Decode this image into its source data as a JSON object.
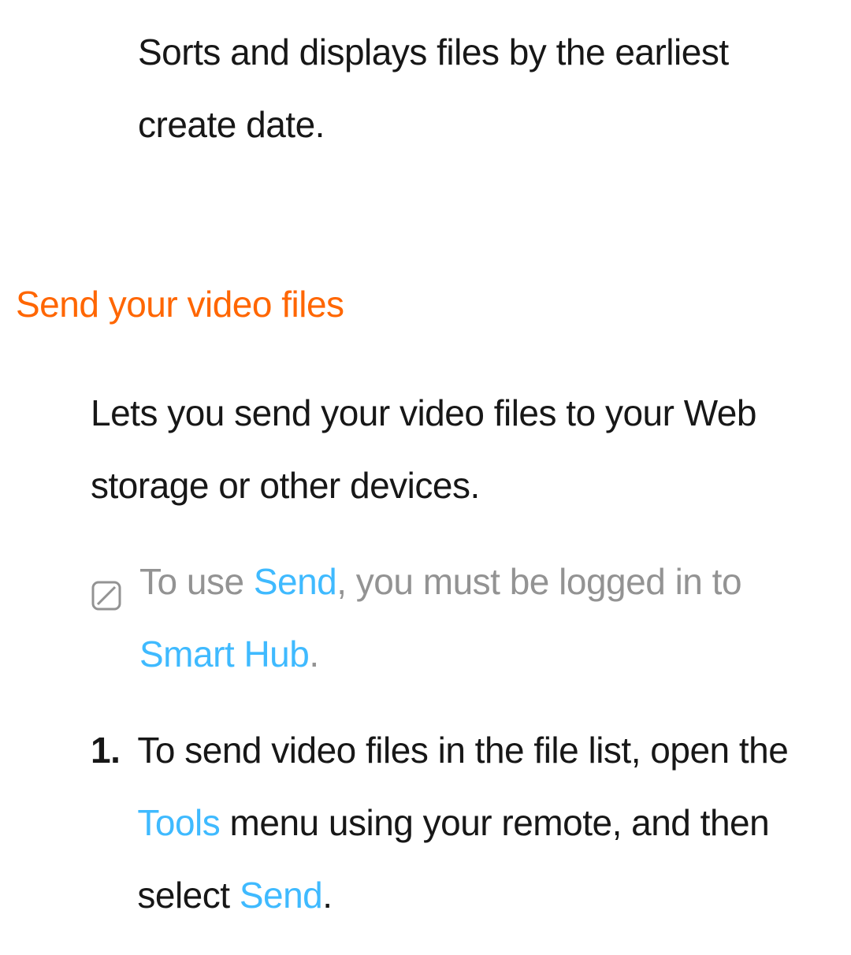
{
  "top_text": "Sorts and displays files by the earliest create date.",
  "heading": "Send your video files",
  "intro": "Lets you send your video files to your Web storage or other devices.",
  "note": {
    "text_a": "To use ",
    "hl_a": "Send",
    "text_b": ", you must be logged in to ",
    "hl_b": "Smart Hub",
    "text_c": "."
  },
  "step1": {
    "num": "1.",
    "text_a": "To send video files in the file list, open the ",
    "hl_a": "Tools",
    "text_b": " menu using your remote, and then select ",
    "hl_b": "Send",
    "text_c": "."
  }
}
